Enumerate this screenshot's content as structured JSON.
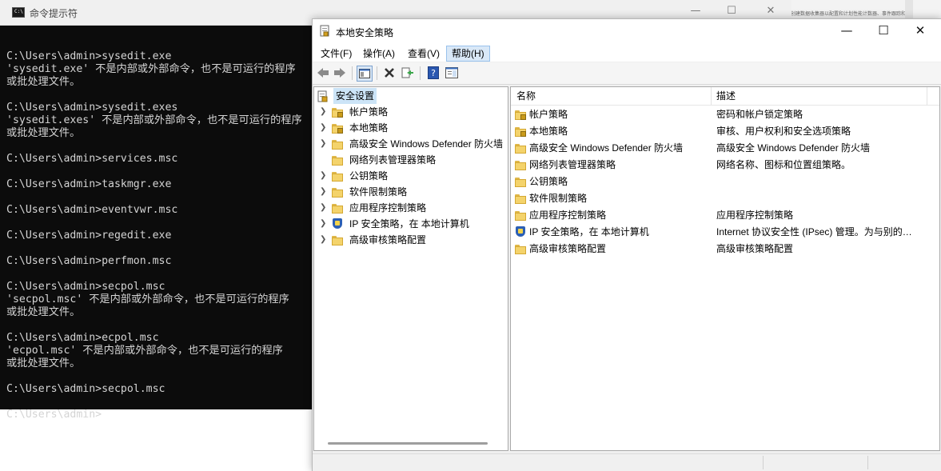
{
  "background": {
    "snippet": "创建数据收集器以配置和计划性能计数器、事件跟踪和配置数据收集"
  },
  "cmd": {
    "title": "命令提示符",
    "icon": "cmd-icon",
    "icon_text": "C:\\",
    "controls": {
      "minimize": "—",
      "maximize": "☐",
      "close": "✕"
    },
    "lines": [
      "",
      "C:\\Users\\admin>sysedit.exe",
      "'sysedit.exe' 不是内部或外部命令，也不是可运行的程序",
      "或批处理文件。",
      "",
      "C:\\Users\\admin>sysedit.exes",
      "'sysedit.exes' 不是内部或外部命令，也不是可运行的程序",
      "或批处理文件。",
      "",
      "C:\\Users\\admin>services.msc",
      "",
      "C:\\Users\\admin>taskmgr.exe",
      "",
      "C:\\Users\\admin>eventvwr.msc",
      "",
      "C:\\Users\\admin>regedit.exe",
      "",
      "C:\\Users\\admin>perfmon.msc",
      "",
      "C:\\Users\\admin>secpol.msc",
      "'secpol.msc' 不是内部或外部命令，也不是可运行的程序",
      "或批处理文件。",
      "",
      "C:\\Users\\admin>ecpol.msc",
      "'ecpol.msc' 不是内部或外部命令，也不是可运行的程序",
      "或批处理文件。",
      "",
      "C:\\Users\\admin>secpol.msc",
      "",
      "C:\\Users\\admin>"
    ]
  },
  "mmc": {
    "title": "本地安全策略",
    "controls": {
      "minimize": "—",
      "maximize": "☐",
      "close": "✕"
    },
    "menu": [
      {
        "label": "文件(F)"
      },
      {
        "label": "操作(A)"
      },
      {
        "label": "查看(V)"
      },
      {
        "label": "帮助(H)"
      }
    ],
    "toolbar": {
      "back": "back-arrow-icon",
      "forward": "forward-arrow-icon",
      "show_hide_tree": "console-tree-icon",
      "delete": "delete-x-icon",
      "export": "export-list-icon",
      "help": "help-icon",
      "properties": "properties-pane-icon",
      "help_glyph": "?"
    },
    "tree": {
      "root": "安全设置",
      "items": [
        {
          "label": "帐户策略",
          "icon": "folder-lock"
        },
        {
          "label": "本地策略",
          "icon": "folder-lock"
        },
        {
          "label": "高级安全 Windows Defender 防火墙",
          "icon": "folder"
        },
        {
          "label": "网络列表管理器策略",
          "icon": "folder"
        },
        {
          "label": "公钥策略",
          "icon": "folder"
        },
        {
          "label": "软件限制策略",
          "icon": "folder"
        },
        {
          "label": "应用程序控制策略",
          "icon": "folder"
        },
        {
          "label": "IP 安全策略，在 本地计算机",
          "icon": "ipsec-shield"
        },
        {
          "label": "高级审核策略配置",
          "icon": "folder"
        }
      ]
    },
    "list": {
      "columns": [
        "名称",
        "描述"
      ],
      "rows": [
        {
          "name": "帐户策略",
          "desc": "密码和帐户锁定策略",
          "icon": "folder-lock"
        },
        {
          "name": "本地策略",
          "desc": "审核、用户权利和安全选项策略",
          "icon": "folder-lock"
        },
        {
          "name": "高级安全 Windows Defender 防火墙",
          "desc": "高级安全 Windows Defender 防火墙",
          "icon": "folder"
        },
        {
          "name": "网络列表管理器策略",
          "desc": "网络名称、图标和位置组策略。",
          "icon": "folder"
        },
        {
          "name": "公钥策略",
          "desc": "",
          "icon": "folder"
        },
        {
          "name": "软件限制策略",
          "desc": "",
          "icon": "folder"
        },
        {
          "name": "应用程序控制策略",
          "desc": "应用程序控制策略",
          "icon": "folder"
        },
        {
          "name": "IP 安全策略，在 本地计算机",
          "desc": "Internet 协议安全性 (IPsec) 管理。为与别的计算机进行安全通讯创建、管理和分配 IP 安全策略。",
          "icon": "ipsec-shield"
        },
        {
          "name": "高级审核策略配置",
          "desc": "高级审核策略配置",
          "icon": "folder"
        }
      ]
    }
  }
}
